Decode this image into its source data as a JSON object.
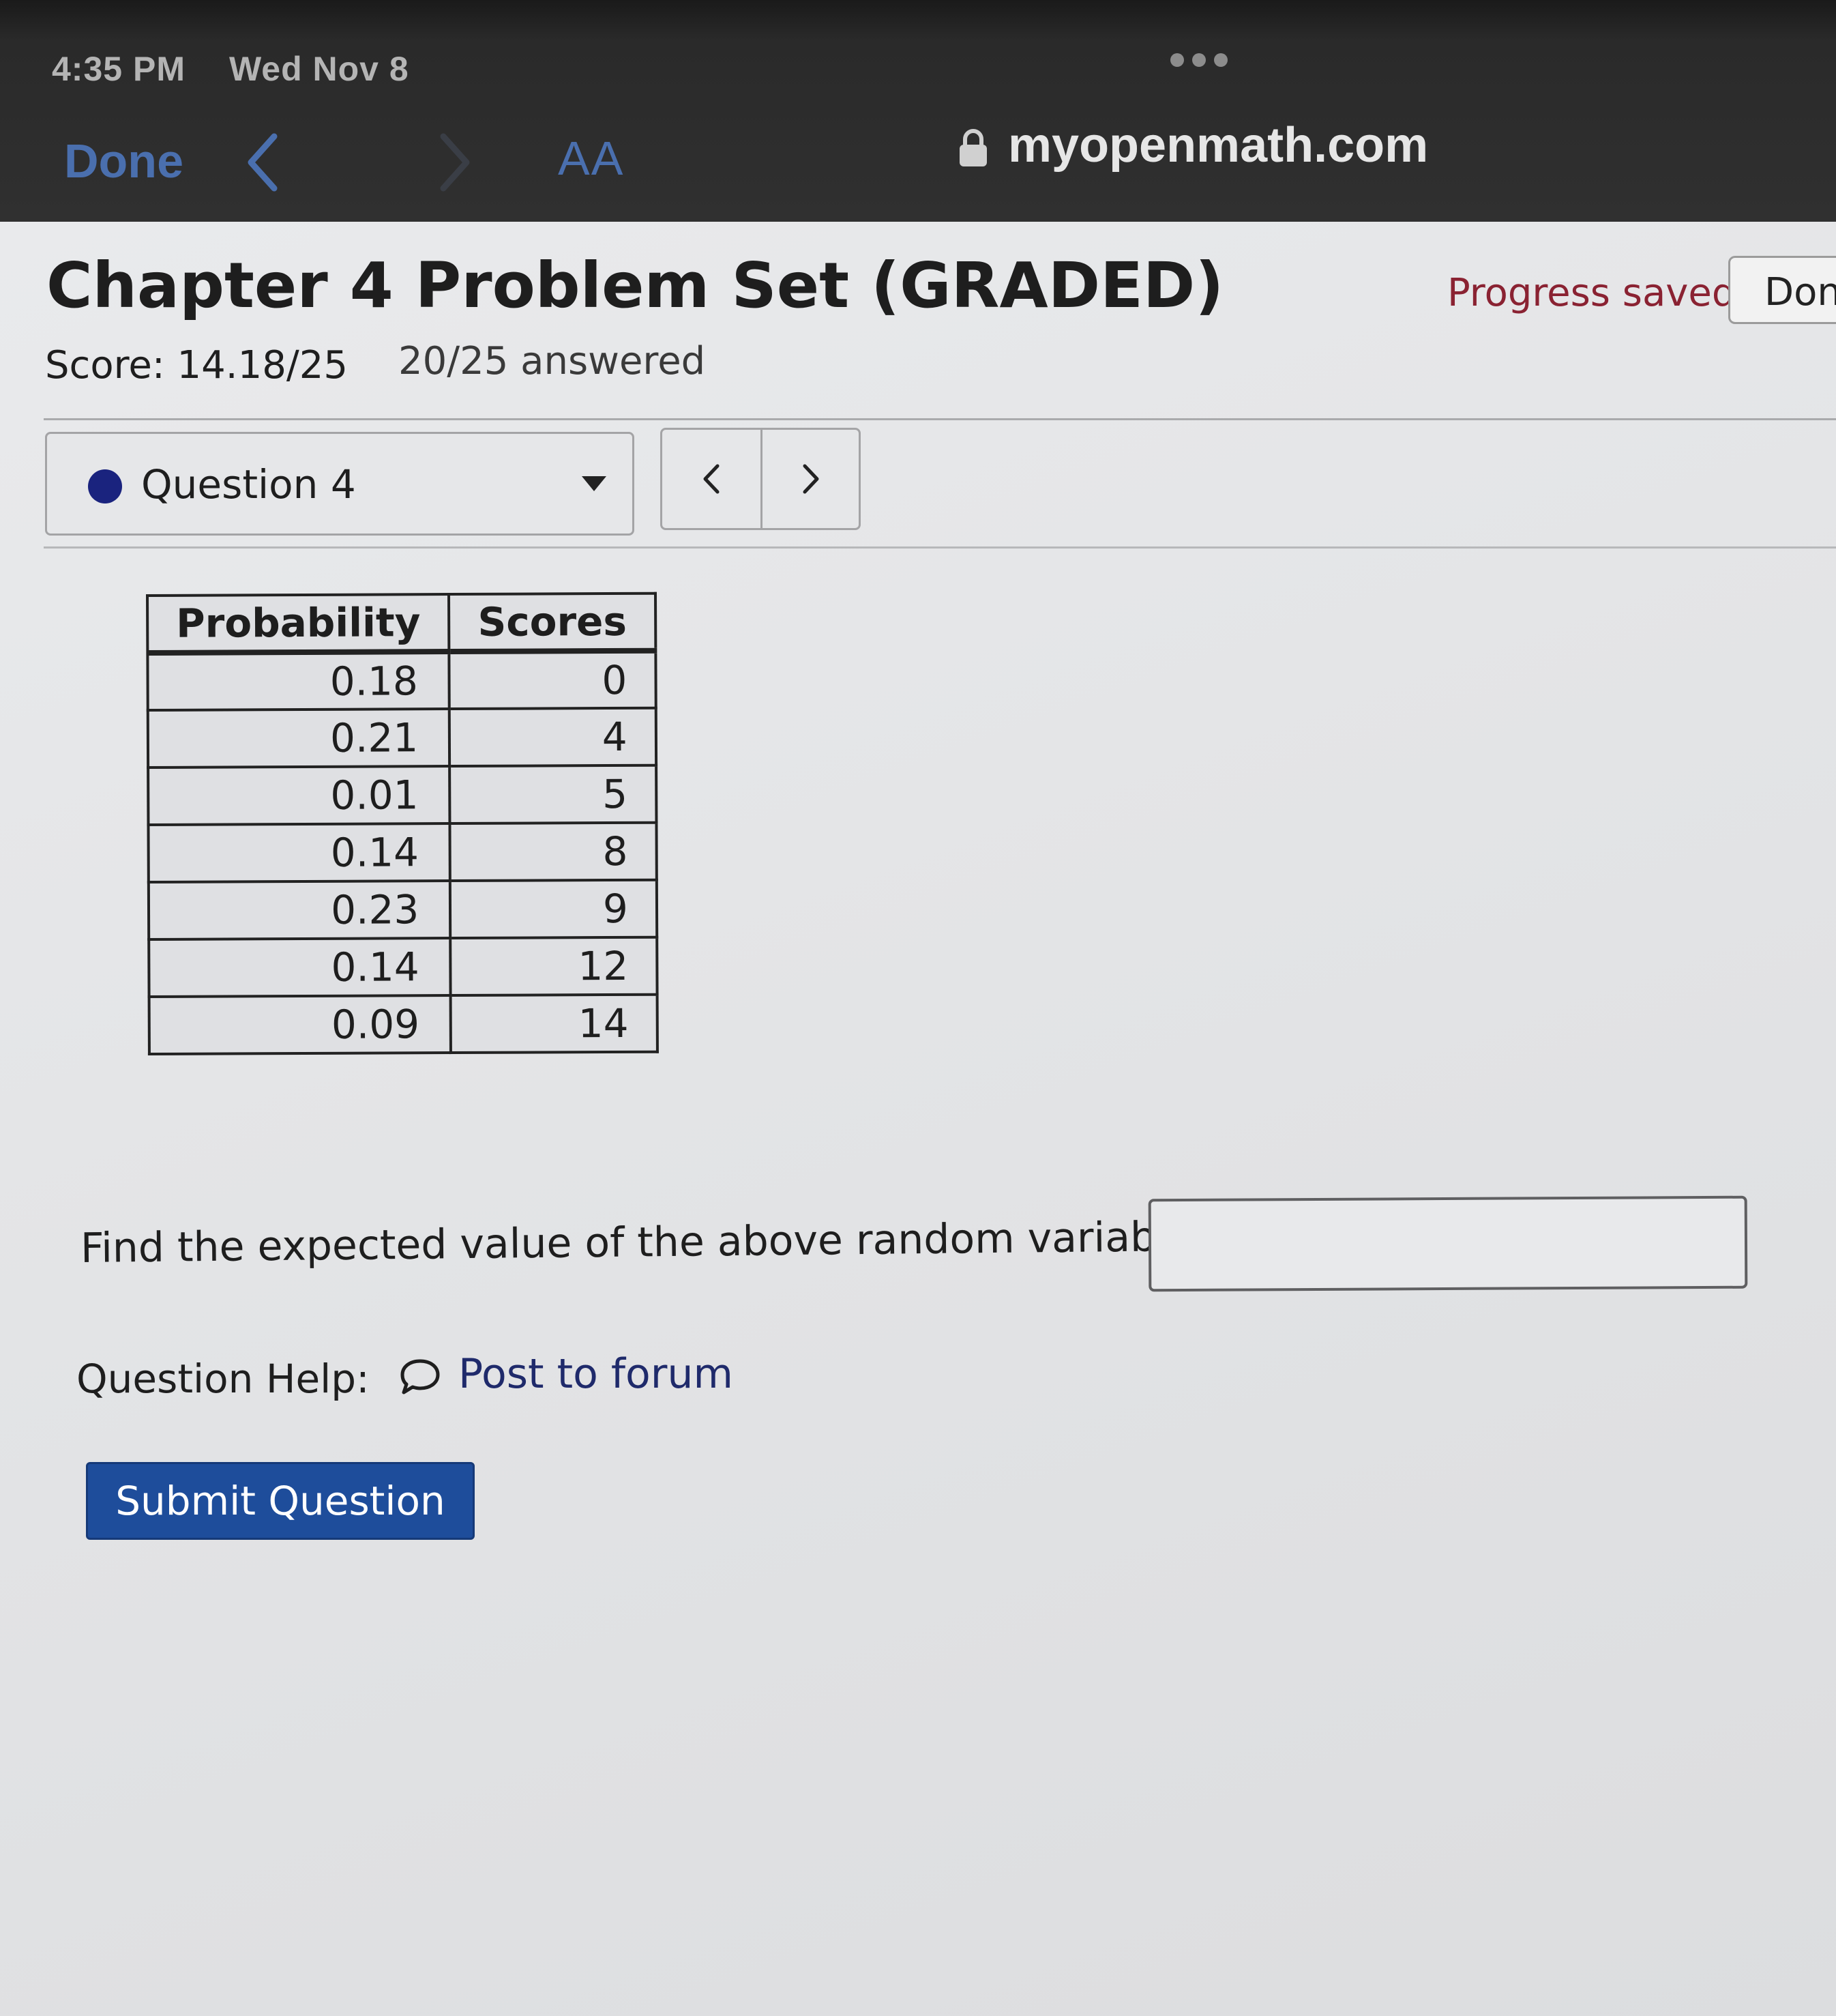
{
  "status_bar": {
    "time": "4:35 PM",
    "date": "Wed Nov 8"
  },
  "browser": {
    "done_label": "Done",
    "reader_label": "AA",
    "url": "myopenmath.com",
    "icons": [
      "back-chevron-icon",
      "forward-chevron-icon",
      "lock-icon",
      "more-dots-icon"
    ]
  },
  "assignment": {
    "title": "Chapter 4 Problem Set (GRADED)",
    "progress_status": "Progress saved",
    "done_button": "Done",
    "score": "Score: 14.18/25",
    "answered": "20/25 answered"
  },
  "question_nav": {
    "selected": "Question 4",
    "status_color": "#1a237e",
    "prev_icon": "chevron-left-icon",
    "next_icon": "chevron-right-icon"
  },
  "table": {
    "headers": [
      "Probability",
      "Scores"
    ],
    "rows": [
      [
        "0.18",
        "0"
      ],
      [
        "0.21",
        "4"
      ],
      [
        "0.01",
        "5"
      ],
      [
        "0.14",
        "8"
      ],
      [
        "0.23",
        "9"
      ],
      [
        "0.14",
        "12"
      ],
      [
        "0.09",
        "14"
      ]
    ]
  },
  "question": {
    "prompt": "Find the expected value of the above random variable.",
    "answer_value": ""
  },
  "help": {
    "label": "Question Help:",
    "forum_link": "Post to forum"
  },
  "submit": {
    "label": "Submit Question",
    "color": "#1e4d9b"
  }
}
